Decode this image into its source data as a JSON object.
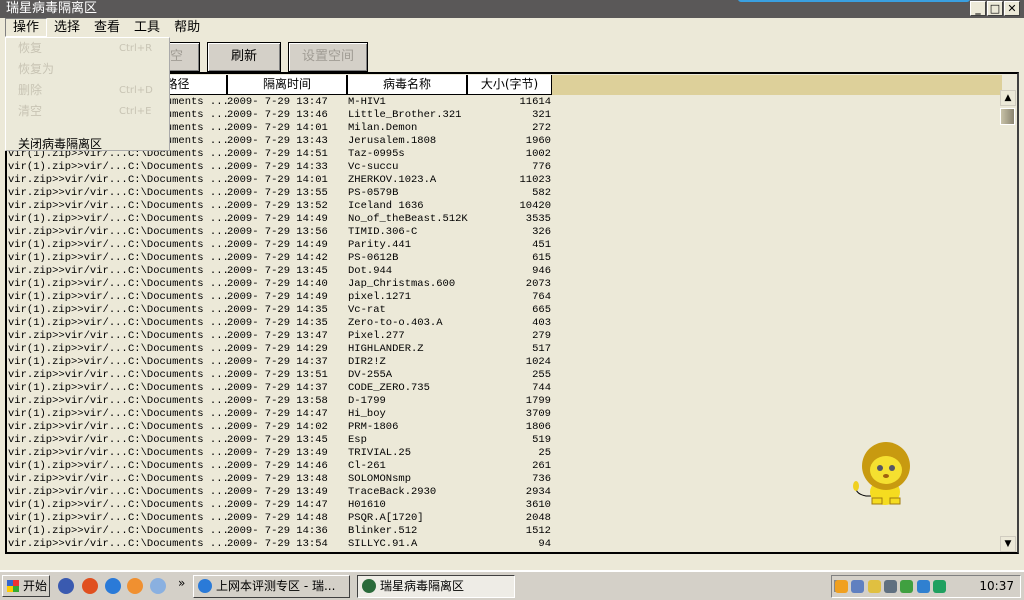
{
  "window": {
    "title": "瑞星病毒隔离区"
  },
  "menubar": [
    "操作",
    "选择",
    "查看",
    "工具",
    "帮助"
  ],
  "dropdown": [
    {
      "label": "恢复",
      "shortcut": "Ctrl+R"
    },
    {
      "label": "恢复为",
      "shortcut": ""
    },
    {
      "label": "删除",
      "shortcut": "Ctrl+D"
    },
    {
      "label": "清空",
      "shortcut": "Ctrl+E"
    },
    {
      "label": "关闭病毒隔离区",
      "shortcut": ""
    }
  ],
  "toolbar": {
    "clear": "清空",
    "refresh": "刷新",
    "set_space": "设置空间"
  },
  "columns": [
    "",
    "路径",
    "隔离时间",
    "病毒名称",
    "大小(字节)"
  ],
  "rows": [
    [
      "",
      "C:\\Documents ...",
      "2009- 7-29 13:47",
      "M-HIV1",
      "11614"
    ],
    [
      "",
      "C:\\Documents ...",
      "2009- 7-29 13:46",
      "Little_Brother.321",
      "321"
    ],
    [
      "",
      "C:\\Documents ...",
      "2009- 7-29 14:01",
      "Milan.Demon",
      "272"
    ],
    [
      "",
      "C:\\Documents ...",
      "2009- 7-29 13:43",
      "Jerusalem.1808",
      "1960"
    ],
    [
      "vir(1).zip>>vir/...",
      "C:\\Documents ...",
      "2009- 7-29 14:51",
      "Taz-0995s",
      "1002"
    ],
    [
      "vir(1).zip>>vir/...",
      "C:\\Documents ...",
      "2009- 7-29 14:33",
      "Vc-succu",
      "776"
    ],
    [
      "vir.zip>>vir/vir...",
      "C:\\Documents ...",
      "2009- 7-29 14:01",
      "ZHERKOV.1023.A",
      "11023"
    ],
    [
      "vir.zip>>vir/vir...",
      "C:\\Documents ...",
      "2009- 7-29 13:55",
      "PS-0579B",
      "582"
    ],
    [
      "vir.zip>>vir/vir...",
      "C:\\Documents ...",
      "2009- 7-29 13:52",
      "Iceland 1636",
      "10420"
    ],
    [
      "vir(1).zip>>vir/...",
      "C:\\Documents ...",
      "2009- 7-29 14:49",
      "No_of_theBeast.512K",
      "3535"
    ],
    [
      "vir.zip>>vir/vir...",
      "C:\\Documents ...",
      "2009- 7-29 13:56",
      "TIMID.306-C",
      "326"
    ],
    [
      "vir(1).zip>>vir/...",
      "C:\\Documents ...",
      "2009- 7-29 14:49",
      "Parity.441",
      "451"
    ],
    [
      "vir(1).zip>>vir/...",
      "C:\\Documents ...",
      "2009- 7-29 14:42",
      "PS-0612B",
      "615"
    ],
    [
      "vir.zip>>vir/vir...",
      "C:\\Documents ...",
      "2009- 7-29 13:45",
      "Dot.944",
      "946"
    ],
    [
      "vir(1).zip>>vir/...",
      "C:\\Documents ...",
      "2009- 7-29 14:40",
      "Jap_Christmas.600",
      "2073"
    ],
    [
      "vir(1).zip>>vir/...",
      "C:\\Documents ...",
      "2009- 7-29 14:49",
      "pixel.1271",
      "764"
    ],
    [
      "vir(1).zip>>vir/...",
      "C:\\Documents ...",
      "2009- 7-29 14:35",
      "Vc-rat",
      "665"
    ],
    [
      "vir(1).zip>>vir/...",
      "C:\\Documents ...",
      "2009- 7-29 14:35",
      "Zero-to-o.403.A",
      "403"
    ],
    [
      "vir.zip>>vir/vir...",
      "C:\\Documents ...",
      "2009- 7-29 13:47",
      "Pixel.277",
      "279"
    ],
    [
      "vir(1).zip>>vir/...",
      "C:\\Documents ...",
      "2009- 7-29 14:29",
      "HIGHLANDER.Z",
      "517"
    ],
    [
      "vir(1).zip>>vir/...",
      "C:\\Documents ...",
      "2009- 7-29 14:37",
      "DIR2!Z",
      "1024"
    ],
    [
      "vir.zip>>vir/vir...",
      "C:\\Documents ...",
      "2009- 7-29 13:51",
      "DV-255A",
      "255"
    ],
    [
      "vir(1).zip>>vir/...",
      "C:\\Documents ...",
      "2009- 7-29 14:37",
      "CODE_ZERO.735",
      "744"
    ],
    [
      "vir.zip>>vir/vir...",
      "C:\\Documents ...",
      "2009- 7-29 13:58",
      "D-1799",
      "1799"
    ],
    [
      "vir(1).zip>>vir/...",
      "C:\\Documents ...",
      "2009- 7-29 14:47",
      "Hi_boy",
      "3709"
    ],
    [
      "vir.zip>>vir/vir...",
      "C:\\Documents ...",
      "2009- 7-29 14:02",
      "PRM-1806",
      "1806"
    ],
    [
      "vir.zip>>vir/vir...",
      "C:\\Documents ...",
      "2009- 7-29 13:45",
      "Esp",
      "519"
    ],
    [
      "vir.zip>>vir/vir...",
      "C:\\Documents ...",
      "2009- 7-29 13:49",
      "TRIVIAL.25",
      "25"
    ],
    [
      "vir(1).zip>>vir/...",
      "C:\\Documents ...",
      "2009- 7-29 14:46",
      "Cl-261",
      "261"
    ],
    [
      "vir.zip>>vir/vir...",
      "C:\\Documents ...",
      "2009- 7-29 13:48",
      "SOLOMONsmp",
      "736"
    ],
    [
      "vir.zip>>vir/vir...",
      "C:\\Documents ...",
      "2009- 7-29 13:49",
      "TraceBack.2930",
      "2934"
    ],
    [
      "vir(1).zip>>vir/...",
      "C:\\Documents ...",
      "2009- 7-29 14:47",
      "H01610",
      "3610"
    ],
    [
      "vir(1).zip>>vir/...",
      "C:\\Documents ...",
      "2009- 7-29 14:48",
      "PSQR.A[1720]",
      "2048"
    ],
    [
      "vir(1).zip>>vir/...",
      "C:\\Documents ...",
      "2009- 7-29 14:36",
      "Blinker.512",
      "1512"
    ],
    [
      "vir.zip>>vir/vir...",
      "C:\\Documents ...",
      "2009- 7-29 13:54",
      "SILLYC.91.A",
      "94"
    ]
  ],
  "taskbar": {
    "start": "开始",
    "chevron": "»",
    "tasks": [
      "上网本评测专区 - 瑞...",
      "瑞星病毒隔离区"
    ],
    "clock": "10:37"
  },
  "colors": {
    "titlebar": "#5a5858",
    "header_fill": "#ddd09a",
    "face": "#ece9d8"
  }
}
